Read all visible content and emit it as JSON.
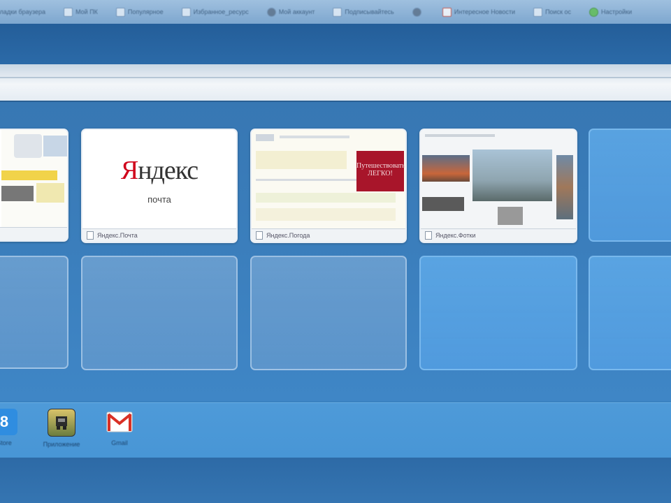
{
  "bookmarks": [
    {
      "label": "Закладки браузера",
      "icon": "page-icon"
    },
    {
      "label": "Мой ПК",
      "icon": "page-icon"
    },
    {
      "label": "Популярное",
      "icon": "page-icon"
    },
    {
      "label": "Избранное_ресурс",
      "icon": "page-icon"
    },
    {
      "label": "Мой аккаунт",
      "icon": "globe-icon"
    },
    {
      "label": "Подписывайтесь",
      "icon": "pen-icon"
    },
    {
      "label": "",
      "icon": "shield-icon"
    },
    {
      "label": "Интересное Новости",
      "icon": "pdf-icon"
    },
    {
      "label": "Поиск ос",
      "icon": "page-icon"
    },
    {
      "label": "Настройки",
      "icon": "green-icon"
    }
  ],
  "tiles": [
    {
      "caption": "",
      "kind": "partial"
    },
    {
      "caption": "Яндекс.Почта",
      "kind": "yandex-mail"
    },
    {
      "caption": "Яндекс.Погода",
      "kind": "weather"
    },
    {
      "caption": "Яндекс.Фотки",
      "kind": "photos"
    }
  ],
  "yandex_mail": {
    "logo_first": "Я",
    "logo_rest": "ндекс",
    "sub": "почта"
  },
  "promo_text": "Путешествовать ЛЕГКО!",
  "dock_apps": [
    {
      "label": "Store",
      "icon": "app-store-icon"
    },
    {
      "label": "Приложение",
      "icon": "game-icon"
    },
    {
      "label": "Gmail",
      "icon": "gmail-icon"
    }
  ],
  "colors": {
    "accent": "#3f86c6",
    "brand_red": "#d0021b"
  }
}
